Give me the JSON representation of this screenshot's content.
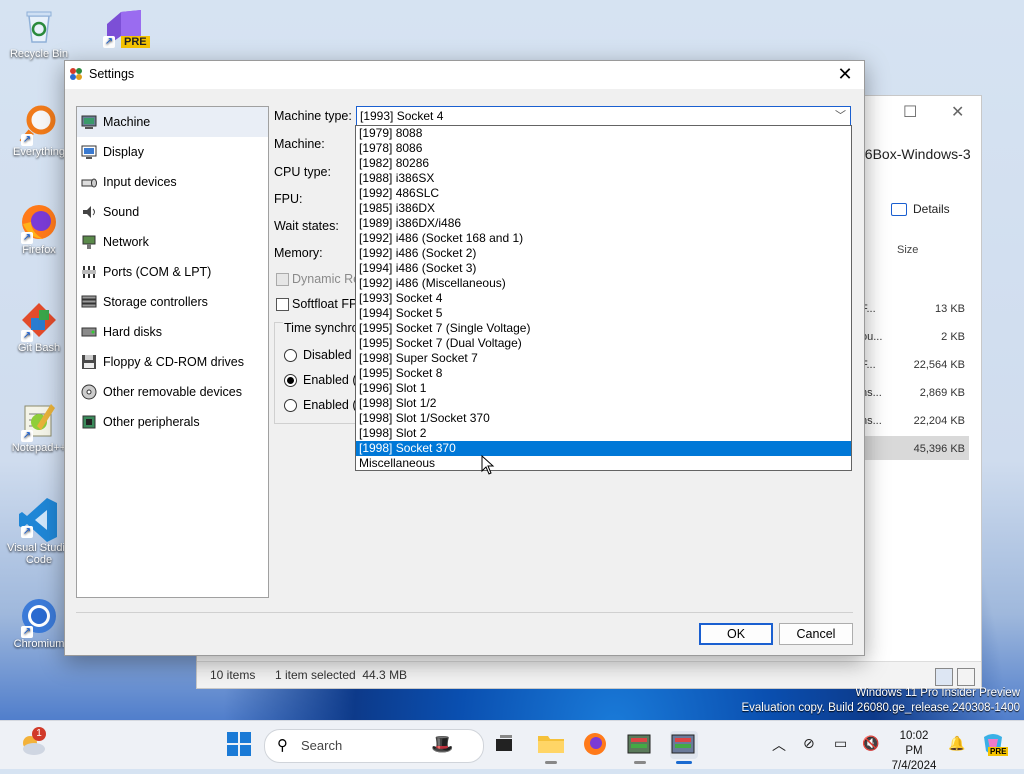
{
  "desktop": {
    "icons": [
      {
        "label": "Recycle Bin",
        "icon": "recycle-bin-icon"
      },
      {
        "label": "Everything",
        "icon": "everything-search-icon"
      },
      {
        "label": "Firefox",
        "icon": "firefox-icon"
      },
      {
        "label": "Git Bash",
        "icon": "git-bash-icon"
      },
      {
        "label": "Notepad++",
        "icon": "notepad-plus-icon"
      },
      {
        "label": "Visual Studio Code",
        "icon": "vscode-icon"
      },
      {
        "label": "Chromium",
        "icon": "chromium-icon"
      }
    ],
    "vs_badge": "PRE",
    "watermark": {
      "line1": "Windows 11 Pro Insider Preview",
      "line2": "Evaluation copy. Build 26080.ge_release.240308-1400"
    }
  },
  "explorer": {
    "path_fragment": "86Box-Windows-3",
    "details_label": "Details",
    "size_header": "Size",
    "rows": [
      {
        "name": "F...",
        "size": "13 KB"
      },
      {
        "name": "ou...",
        "size": "2 KB"
      },
      {
        "name": "F...",
        "size": "22,564 KB"
      },
      {
        "name": "ns...",
        "size": "2,869 KB"
      },
      {
        "name": "ns...",
        "size": "22,204 KB"
      },
      {
        "name": "",
        "size": "45,396 KB"
      }
    ],
    "status": {
      "count": "10 items",
      "selected": "1 item selected  44.3 MB"
    }
  },
  "dialog": {
    "title": "Settings",
    "nav": [
      {
        "label": "Machine",
        "icon": "machine-icon"
      },
      {
        "label": "Display",
        "icon": "display-icon"
      },
      {
        "label": "Input devices",
        "icon": "input-devices-icon"
      },
      {
        "label": "Sound",
        "icon": "sound-icon"
      },
      {
        "label": "Network",
        "icon": "network-icon"
      },
      {
        "label": "Ports (COM & LPT)",
        "icon": "ports-icon"
      },
      {
        "label": "Storage controllers",
        "icon": "storage-controllers-icon"
      },
      {
        "label": "Hard disks",
        "icon": "hard-disk-icon"
      },
      {
        "label": "Floppy & CD-ROM drives",
        "icon": "floppy-cdrom-icon"
      },
      {
        "label": "Other removable devices",
        "icon": "removable-devices-icon"
      },
      {
        "label": "Other peripherals",
        "icon": "peripherals-icon"
      }
    ],
    "form": {
      "machine_type_label": "Machine type:",
      "machine_type_value": "[1993] Socket 4",
      "machine_label": "Machine:",
      "cpu_type_label": "CPU type:",
      "fpu_label": "FPU:",
      "wait_states_label": "Wait states:",
      "memory_label": "Memory:",
      "dynamic_recompiler_label": "Dynamic Re",
      "softfloat_label": "Softfloat FPU",
      "time_sync_label": "Time synchro",
      "radio_disabled": "Disabled",
      "radio_enabled_local": "Enabled (l",
      "radio_enabled_utc": "Enabled (U"
    },
    "dropdown_options": [
      "[1979] 8088",
      "[1978] 8086",
      "[1982] 80286",
      "[1988] i386SX",
      "[1992] 486SLC",
      "[1985] i386DX",
      "[1989] i386DX/i486",
      "[1992] i486 (Socket 168 and 1)",
      "[1992] i486 (Socket 2)",
      "[1994] i486 (Socket 3)",
      "[1992] i486 (Miscellaneous)",
      "[1993] Socket 4",
      "[1994] Socket 5",
      "[1995] Socket 7 (Single Voltage)",
      "[1995] Socket 7 (Dual Voltage)",
      "[1998] Super Socket 7",
      "[1995] Socket 8",
      "[1996] Slot 1",
      "[1998] Slot 1/2",
      "[1998] Slot 1/Socket 370",
      "[1998] Slot 2",
      "[1998] Socket 370",
      "Miscellaneous"
    ],
    "highlighted_option": "[1998] Socket 370",
    "ok_label": "OK",
    "cancel_label": "Cancel"
  },
  "taskbar": {
    "search_placeholder": "Search",
    "weather_badge": "1",
    "time": "10:02 PM",
    "date": "7/4/2024",
    "copilot_badge": "PRE"
  },
  "colors": {
    "accent": "#0078d7",
    "focus": "#1a5fd0"
  }
}
